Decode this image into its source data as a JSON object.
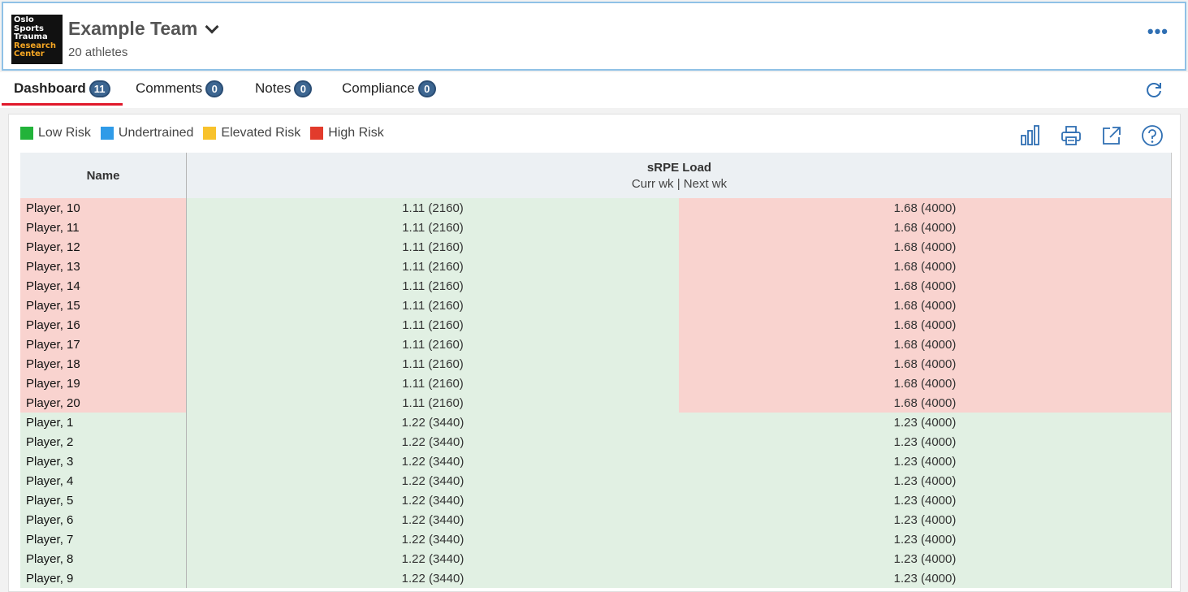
{
  "header": {
    "logo_lines": [
      "Oslo",
      "Sports",
      "Trauma",
      "Research",
      "Center"
    ],
    "team_name": "Example Team",
    "subtitle": "20 athletes",
    "more_label": "•••"
  },
  "tabs": [
    {
      "label": "Dashboard",
      "badge": "11",
      "active": true
    },
    {
      "label": "Comments",
      "badge": "0",
      "active": false
    },
    {
      "label": "Notes",
      "badge": "0",
      "active": false
    },
    {
      "label": "Compliance",
      "badge": "0",
      "active": false
    }
  ],
  "legend": [
    {
      "label": "Low Risk",
      "color": "#22b33a"
    },
    {
      "label": "Undertrained",
      "color": "#2f9be8"
    },
    {
      "label": "Elevated Risk",
      "color": "#f8c22c"
    },
    {
      "label": "High Risk",
      "color": "#e23b2c"
    }
  ],
  "toolbar": {
    "icons": [
      "bar-chart-icon",
      "print-icon",
      "export-icon",
      "help-icon"
    ]
  },
  "table": {
    "col_name": "Name",
    "col_load_title": "sRPE Load",
    "col_load_sub": "Curr wk | Next wk",
    "rows": [
      {
        "name": "Player, 10",
        "curr": "1.11 (2160)",
        "next": "1.68 (4000)",
        "risk": [
          "red",
          "green",
          "red"
        ]
      },
      {
        "name": "Player, 11",
        "curr": "1.11 (2160)",
        "next": "1.68 (4000)",
        "risk": [
          "red",
          "green",
          "red"
        ]
      },
      {
        "name": "Player, 12",
        "curr": "1.11 (2160)",
        "next": "1.68 (4000)",
        "risk": [
          "red",
          "green",
          "red"
        ]
      },
      {
        "name": "Player, 13",
        "curr": "1.11 (2160)",
        "next": "1.68 (4000)",
        "risk": [
          "red",
          "green",
          "red"
        ]
      },
      {
        "name": "Player, 14",
        "curr": "1.11 (2160)",
        "next": "1.68 (4000)",
        "risk": [
          "red",
          "green",
          "red"
        ]
      },
      {
        "name": "Player, 15",
        "curr": "1.11 (2160)",
        "next": "1.68 (4000)",
        "risk": [
          "red",
          "green",
          "red"
        ]
      },
      {
        "name": "Player, 16",
        "curr": "1.11 (2160)",
        "next": "1.68 (4000)",
        "risk": [
          "red",
          "green",
          "red"
        ]
      },
      {
        "name": "Player, 17",
        "curr": "1.11 (2160)",
        "next": "1.68 (4000)",
        "risk": [
          "red",
          "green",
          "red"
        ]
      },
      {
        "name": "Player, 18",
        "curr": "1.11 (2160)",
        "next": "1.68 (4000)",
        "risk": [
          "red",
          "green",
          "red"
        ]
      },
      {
        "name": "Player, 19",
        "curr": "1.11 (2160)",
        "next": "1.68 (4000)",
        "risk": [
          "red",
          "green",
          "red"
        ]
      },
      {
        "name": "Player, 20",
        "curr": "1.11 (2160)",
        "next": "1.68 (4000)",
        "risk": [
          "red",
          "green",
          "red"
        ]
      },
      {
        "name": "Player, 1",
        "curr": "1.22 (3440)",
        "next": "1.23 (4000)",
        "risk": [
          "green",
          "green",
          "green"
        ]
      },
      {
        "name": "Player, 2",
        "curr": "1.22 (3440)",
        "next": "1.23 (4000)",
        "risk": [
          "green",
          "green",
          "green"
        ]
      },
      {
        "name": "Player, 3",
        "curr": "1.22 (3440)",
        "next": "1.23 (4000)",
        "risk": [
          "green",
          "green",
          "green"
        ]
      },
      {
        "name": "Player, 4",
        "curr": "1.22 (3440)",
        "next": "1.23 (4000)",
        "risk": [
          "green",
          "green",
          "green"
        ]
      },
      {
        "name": "Player, 5",
        "curr": "1.22 (3440)",
        "next": "1.23 (4000)",
        "risk": [
          "green",
          "green",
          "green"
        ]
      },
      {
        "name": "Player, 6",
        "curr": "1.22 (3440)",
        "next": "1.23 (4000)",
        "risk": [
          "green",
          "green",
          "green"
        ]
      },
      {
        "name": "Player, 7",
        "curr": "1.22 (3440)",
        "next": "1.23 (4000)",
        "risk": [
          "green",
          "green",
          "green"
        ]
      },
      {
        "name": "Player, 8",
        "curr": "1.22 (3440)",
        "next": "1.23 (4000)",
        "risk": [
          "green",
          "green",
          "green"
        ]
      },
      {
        "name": "Player, 9",
        "curr": "1.22 (3440)",
        "next": "1.23 (4000)",
        "risk": [
          "green",
          "green",
          "green"
        ]
      }
    ]
  }
}
